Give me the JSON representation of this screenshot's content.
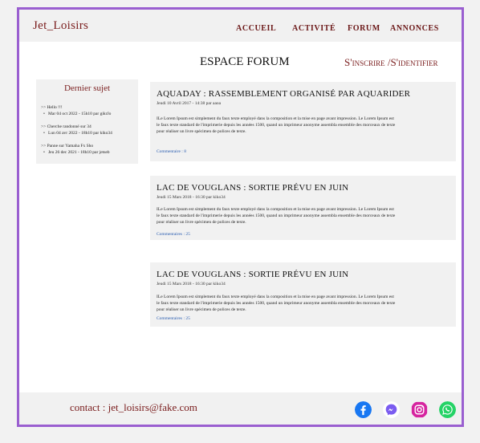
{
  "logo": "Jet_Loisirs",
  "nav": {
    "accueil": "ACCUEIL",
    "activite": "ACTIVITÉ",
    "forum": "FORUM",
    "annonces": "ANNONCES"
  },
  "page_title": "ESPACE FORUM",
  "auth": "S'inscrire /S'identifier",
  "sidebar": {
    "title": "Dernier sujet",
    "entries": [
      {
        "topic": ">> Hello !!!",
        "detail": "Mar 04 oct 2022 - 15h10 par gikrJo"
      },
      {
        "topic": ">> Cherche randonné sur 34",
        "detail": "Lun 04 avr 2022 - 18h10 par kiko34"
      },
      {
        "topic": ">> Panne sur Yamaha Fx Sho",
        "detail": "Jeu 26 dec 2021 - 18h10 par jetseb"
      }
    ]
  },
  "posts": [
    {
      "title": "AQUADAY : RASSEMBLEMENT ORGANISÉ PAR AQUARIDER",
      "meta": "Jeudi 10 Avril 2017 - 14:38 par aaoa",
      "body": "ILe Lorem Ipsum est simplement du faux texte employé dans la composition et la mise en page avant impression. Le Lorem Ipsum est le faux texte standard de l'imprimerie depuis les années 1500, quand un imprimeur anonyme assembla ensemble des morceaux de texte pour réaliser un livre spécimen de polices de texte.",
      "comments": "Commentaire : 8"
    },
    {
      "title": "LAC DE VOUGLANS : SORTIE PRÉVU EN JUIN",
      "meta": "Jeudi 15 Mars 2018 - 16:30 par kiko34",
      "body": "ILe Lorem Ipsum est simplement du faux texte employé dans la composition et la mise en page avant impression. Le Lorem Ipsum est le faux texte standard de l'imprimerie depuis les années 1500, quand un imprimeur anonyme assembla ensemble des morceaux de texte pour réaliser un livre spécimen de polices de texte.",
      "comments": "Commentaires : 25"
    },
    {
      "title": "LAC DE VOUGLANS : SORTIE PRÉVU EN JUIN",
      "meta": "Jeudi 15 Mars 2018 - 16:30 par kiko34",
      "body": "ILe Lorem Ipsum est simplement du faux texte employé dans la composition et la mise en page avant impression. Le Lorem Ipsum est le faux texte standard de l'imprimerie depuis les années 1500, quand un imprimeur anonyme assembla ensemble des morceaux de texte pour réaliser un livre spécimen de polices de texte.",
      "comments": "Commentaires : 25"
    }
  ],
  "footer": {
    "contact": "contact : jet_loisirs@fake.com"
  },
  "social_icons": [
    "facebook-icon",
    "messenger-icon",
    "instagram-icon",
    "whatsapp-icon"
  ],
  "colors": {
    "accent": "#9a5fd0",
    "brand": "#7a1d1d",
    "link": "#2a5db0",
    "panel": "#f1f1f1"
  }
}
